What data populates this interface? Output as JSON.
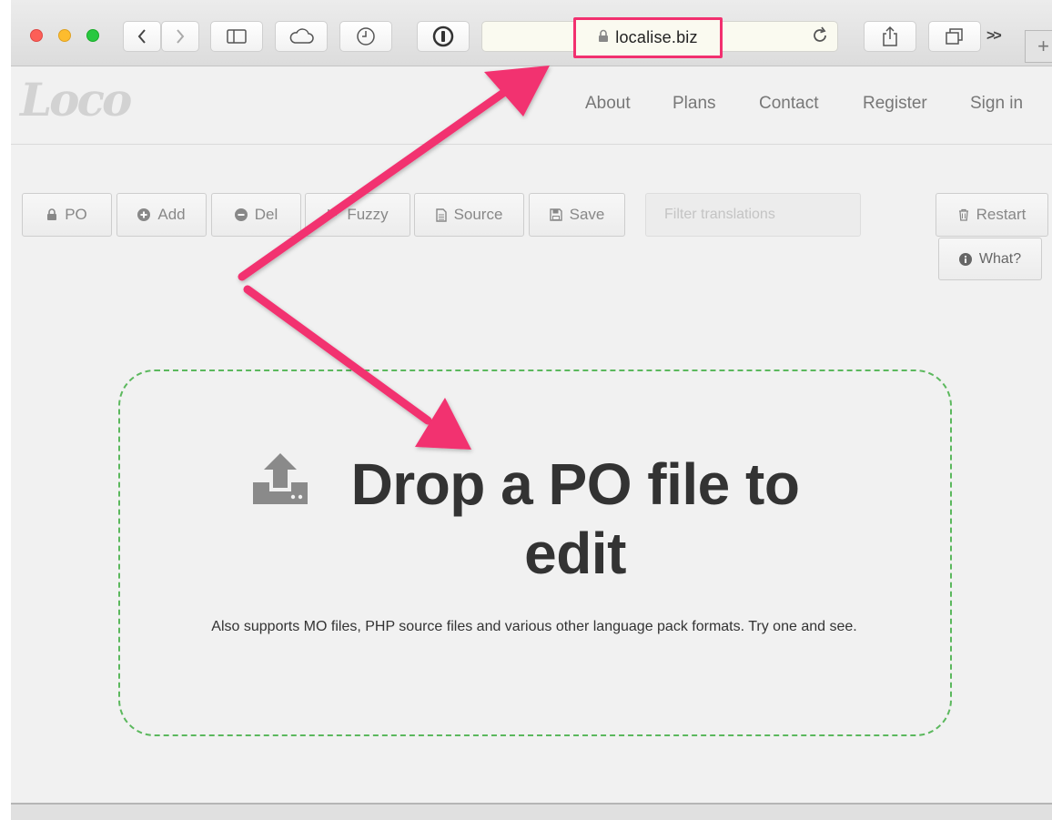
{
  "browser": {
    "url": "localise.biz",
    "icons": {
      "back": "chevron-left-icon",
      "forward": "chevron-right-icon",
      "sidebar": "sidebar-icon",
      "cloud": "cloud-icon",
      "history": "clock-icon",
      "password": "1password-icon",
      "lock": "lock-icon",
      "reload": "reload-icon",
      "share": "share-icon",
      "tabs": "tabs-icon",
      "overflow": "double-chevron-icon",
      "new_tab": "plus-icon"
    },
    "overflow_label": ">>",
    "new_tab_label": "+"
  },
  "site": {
    "logo": "Loco",
    "nav": [
      "About",
      "Plans",
      "Contact",
      "Register",
      "Sign in"
    ]
  },
  "toolbar": {
    "po": "PO",
    "add": "Add",
    "del": "Del",
    "fuzzy": "Fuzzy",
    "source": "Source",
    "save": "Save",
    "filter_placeholder": "Filter translations",
    "restart": "Restart",
    "what": "What?"
  },
  "dropzone": {
    "title": "Drop a PO file to edit",
    "subtitle": "Also supports MO files, PHP source files and various other language pack formats. Try one and see."
  },
  "colors": {
    "annotation": "#f2306f",
    "dropzone_border": "#5bb85d",
    "text": "#333333",
    "nav": "#777777"
  }
}
